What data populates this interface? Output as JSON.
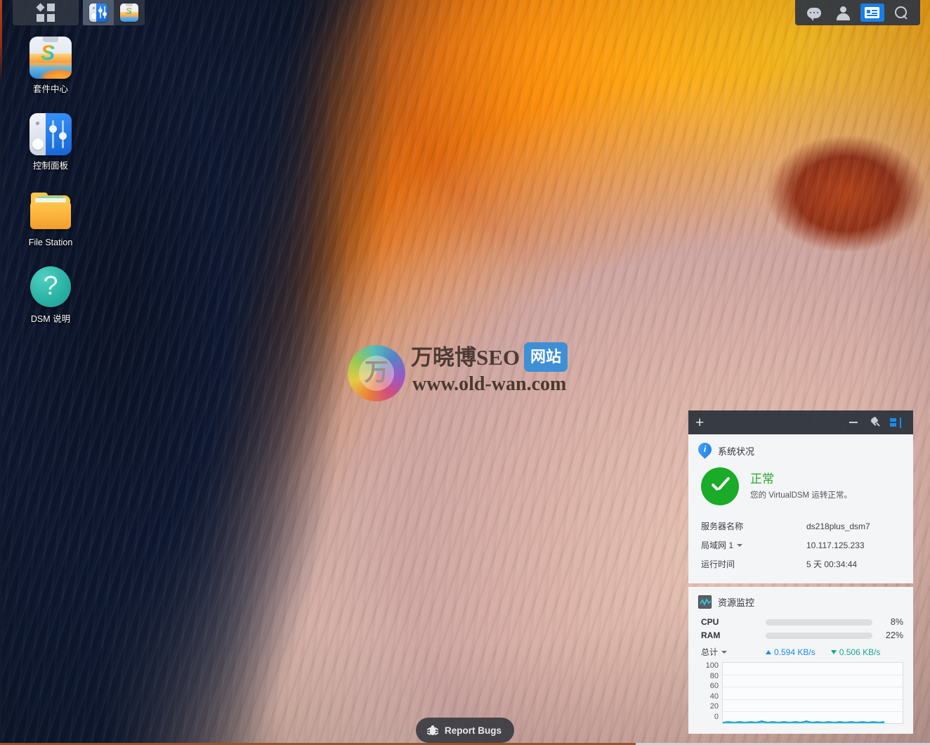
{
  "taskbar": {
    "show_desktop_icon": "grid-icon",
    "apps": [
      {
        "name": "control-panel",
        "title": "控制面板",
        "icon": "control-panel-icon",
        "active": true
      },
      {
        "name": "package-center",
        "title": "套件中心",
        "icon": "package-center-icon",
        "active": false
      }
    ],
    "tray": [
      {
        "name": "notifications-chat",
        "icon": "chat-bubble-icon",
        "selected": false
      },
      {
        "name": "user-account",
        "icon": "person-icon",
        "selected": false
      },
      {
        "name": "widgets",
        "icon": "widget-panel-icon",
        "selected": true
      },
      {
        "name": "search",
        "icon": "search-icon",
        "selected": false
      }
    ]
  },
  "desktop": {
    "icons": [
      {
        "label": "套件中心",
        "icon": "package-center-icon"
      },
      {
        "label": "控制面板",
        "icon": "control-panel-icon"
      },
      {
        "label": "File Station",
        "icon": "folder-icon"
      },
      {
        "label": "DSM 说明",
        "icon": "question-mark-icon"
      }
    ],
    "report_bugs": {
      "label": "Report Bugs",
      "icon": "bug-icon"
    },
    "watermark": {
      "logo_char": "万",
      "line1": "万晓博SEO",
      "badge": "网站",
      "line2": "www.old-wan.com"
    }
  },
  "widget_panel": {
    "header": {
      "add_label": "+",
      "minimize": "minimize-icon",
      "pin": "pin-icon",
      "dock": "dock-icon"
    },
    "system_health": {
      "title": "系统状况",
      "icon": "info-pin-icon",
      "status_icon": "green-check-icon",
      "status_title": "正常",
      "status_sub": "您的 VirtualDSM 运转正常。",
      "rows": [
        {
          "key": "服务器名称",
          "value": "ds218plus_dsm7",
          "dropdown": false
        },
        {
          "key": "局域网 1",
          "value": "10.117.125.233",
          "dropdown": true
        },
        {
          "key": "运行时间",
          "value": "5 天 00:34:44",
          "dropdown": false
        }
      ]
    },
    "resource_monitor": {
      "title": "资源监控",
      "icon": "resource-monitor-icon",
      "meters": [
        {
          "label": "CPU",
          "value": "8%",
          "percent": 8
        },
        {
          "label": "RAM",
          "value": "22%",
          "percent": 22
        }
      ],
      "network": {
        "scope_label": "总计",
        "upload": "0.594 KB/s",
        "download": "0.506 KB/s"
      }
    }
  },
  "chart_data": {
    "type": "line",
    "title": "",
    "xlabel": "",
    "ylabel": "",
    "ylim": [
      0,
      100
    ],
    "grid": true,
    "legend": "none",
    "yticks": [
      "100",
      "80",
      "60",
      "40",
      "20",
      "0"
    ],
    "series": [
      {
        "name": "上传",
        "color": "#1565c0",
        "values": [
          1,
          2,
          1,
          2,
          1,
          2,
          1,
          3,
          1,
          2,
          1,
          2,
          1,
          2,
          1,
          3,
          1,
          2,
          1,
          2,
          1,
          2,
          1,
          2,
          1,
          2,
          1,
          2,
          1,
          2
        ]
      },
      {
        "name": "下载",
        "color": "#13b7d4",
        "values": [
          1,
          1,
          1,
          1,
          1,
          1,
          1,
          2,
          1,
          1,
          1,
          1,
          1,
          1,
          1,
          2,
          1,
          1,
          1,
          1,
          1,
          1,
          1,
          1,
          1,
          1,
          1,
          1,
          1,
          1
        ]
      }
    ]
  },
  "colors": {
    "accent_blue": "#1a8ced",
    "status_green": "#25a62f",
    "download_teal": "#13a79a",
    "taskbar_bg": "#2f3642"
  }
}
